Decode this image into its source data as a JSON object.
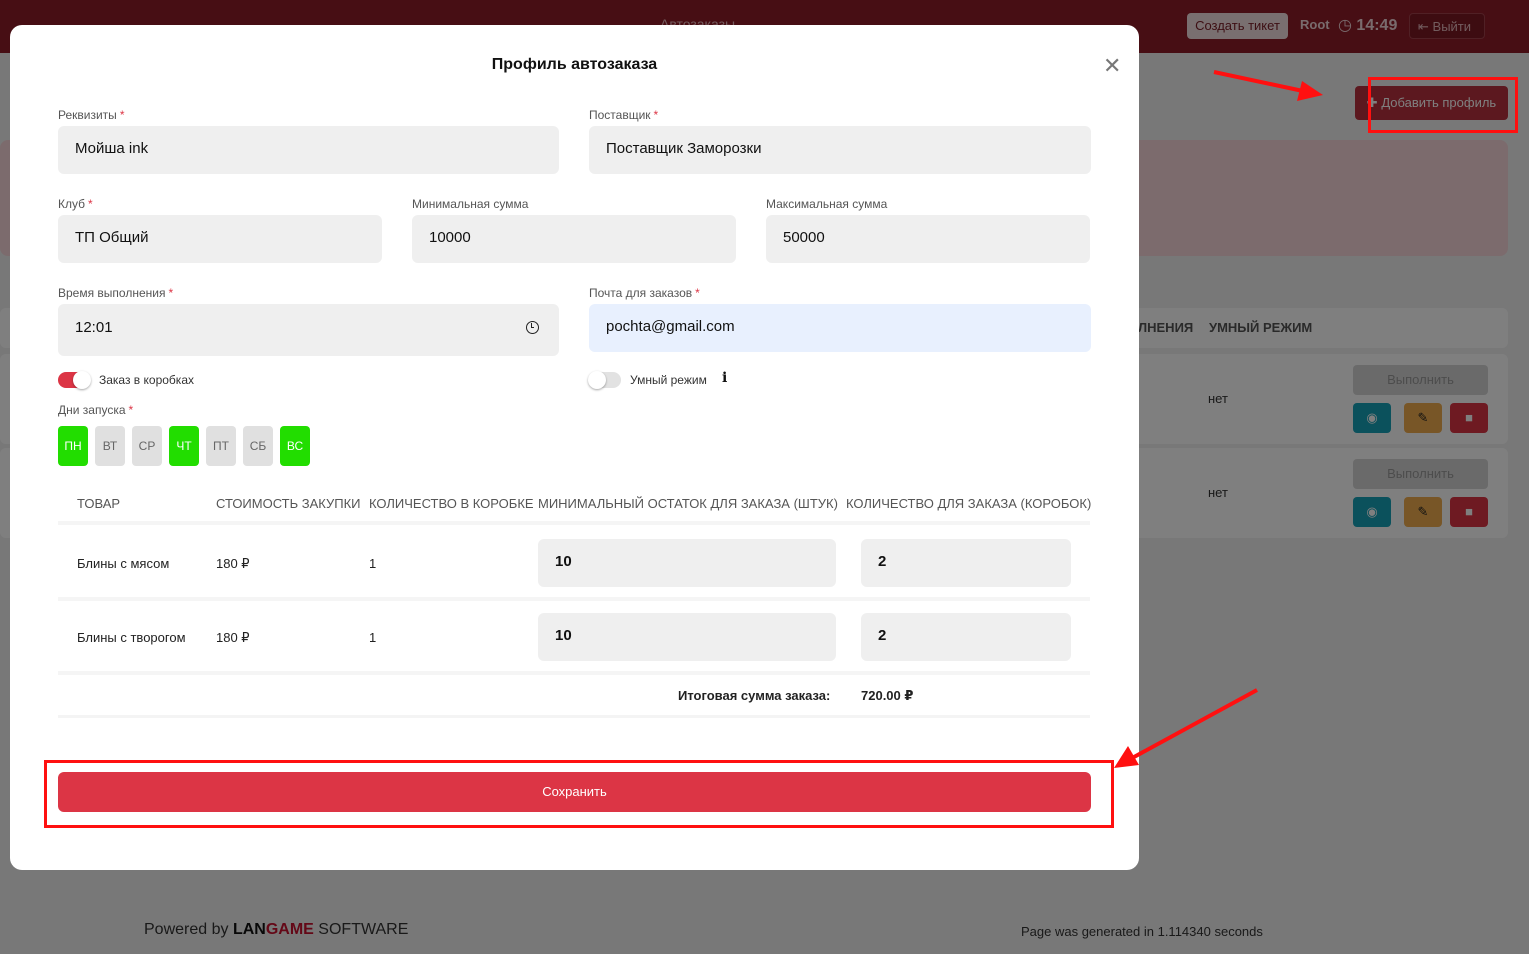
{
  "topbar": {
    "title": "Автозаказы",
    "ticket_button": "Создать тикет",
    "user": "Root",
    "clock": "14:49",
    "logout_button": "Выйти"
  },
  "page": {
    "add_profile_button": "Добавить профиль",
    "table_headers": [
      "ЛНЕНИЯ",
      "УМНЫЙ РЕЖИМ"
    ],
    "rows": [
      {
        "smart_mode": "нет",
        "execute": "Выполнить"
      },
      {
        "smart_mode": "нет",
        "execute": "Выполнить"
      }
    ]
  },
  "footer": {
    "powered": "Powered by",
    "brand_a": "LAN",
    "brand_b": "GAME",
    "brand_c": "SOFTWARE",
    "generated": "Page was generated in 1.114340 seconds"
  },
  "modal": {
    "title": "Профиль автозаказа",
    "fields": {
      "requisites": {
        "label": "Реквизиты",
        "value": "Мойша ink"
      },
      "supplier": {
        "label": "Поставщик",
        "value": "Поставщик Заморозки"
      },
      "club": {
        "label": "Клуб",
        "value": "ТП Общий"
      },
      "min_sum": {
        "label": "Минимальная сумма",
        "value": "10000"
      },
      "max_sum": {
        "label": "Максимальная сумма",
        "value": "50000"
      },
      "exec_time": {
        "label": "Время выполнения",
        "value": "12:01"
      },
      "email": {
        "label": "Почта для заказов",
        "value": "pochta@gmail.com"
      }
    },
    "toggles": {
      "boxes": {
        "label": "Заказ в коробках",
        "on": true
      },
      "smart": {
        "label": "Умный режим",
        "on": false
      }
    },
    "days_label": "Дни запуска",
    "days": [
      {
        "label": "ПН",
        "on": true
      },
      {
        "label": "ВТ",
        "on": false
      },
      {
        "label": "СР",
        "on": false
      },
      {
        "label": "ЧТ",
        "on": true
      },
      {
        "label": "ПТ",
        "on": false
      },
      {
        "label": "СБ",
        "on": false
      },
      {
        "label": "ВС",
        "on": true
      }
    ],
    "table": {
      "headers": [
        "ТОВАР",
        "СТОИМОСТЬ ЗАКУПКИ",
        "КОЛИЧЕСТВО В КОРОБКЕ",
        "МИНИМАЛЬНЫЙ ОСТАТОК ДЛЯ ЗАКАЗА (ШТУК)",
        "КОЛИЧЕСТВО ДЛЯ ЗАКАЗА (КОРОБОК)"
      ],
      "rows": [
        {
          "product": "Блины с мясом",
          "price": "180 ₽",
          "per_box": "1",
          "min_stock": "10",
          "order_boxes": "2"
        },
        {
          "product": "Блины с творогом",
          "price": "180 ₽",
          "per_box": "1",
          "min_stock": "10",
          "order_boxes": "2"
        }
      ],
      "total_label": "Итоговая сумма заказа:",
      "total_value": "720.00 ₽"
    },
    "save_button": "Сохранить"
  },
  "colors": {
    "brand": "#8e1d28",
    "accent": "#dc3545",
    "day_active": "#22dd00",
    "annotation": "#ff1010"
  }
}
